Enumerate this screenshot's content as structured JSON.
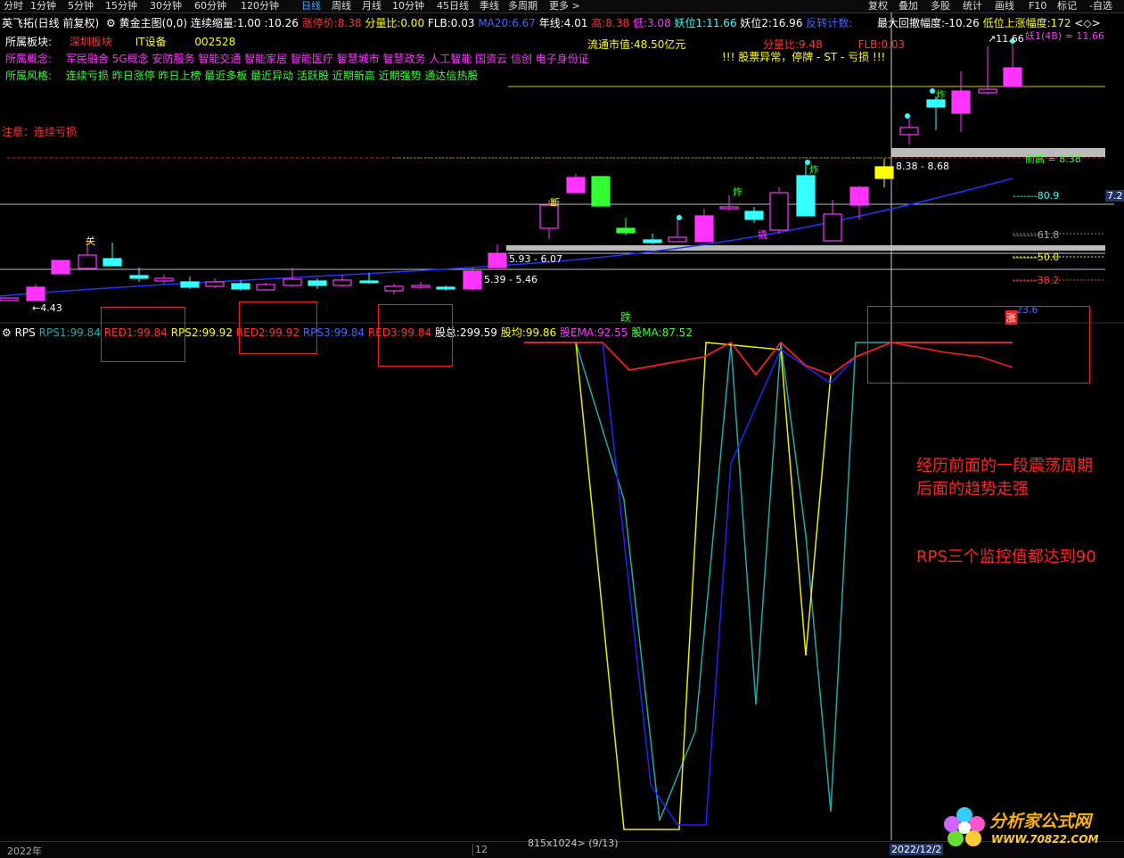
{
  "toolbar": {
    "items": [
      "分时",
      "1分钟",
      "5分钟",
      "15分钟",
      "30分钟",
      "60分钟",
      "120分钟",
      "日线",
      "周线",
      "月线",
      "10分钟",
      "45日线",
      "季线",
      "多周期",
      "更多 >"
    ],
    "active": "日线",
    "right_items": [
      "复权",
      "叠加",
      "多股",
      "统计",
      "画线",
      "F10",
      "标记",
      "-自选"
    ]
  },
  "header": {
    "stock_line": "英飞拓(日线 前复权)",
    "main_indicator": "黄金主图(0,0)",
    "continuous_shrink_label": "连续缩量:",
    "continuous_shrink_value": "1.00",
    "price_value": ":10.26",
    "limit_price_label": "涨停价:",
    "limit_price_value": "8.38",
    "fenliangbi_label": "分量比:",
    "fenliangbi_value": "0.00",
    "flb_label": "FLB:",
    "flb_value": "0.03",
    "ma20_label": "MA20:",
    "ma20_value": "6.67",
    "yearline_label": "年线:",
    "yearline_value": "4.01",
    "high_label": "高:",
    "high_value": "8.38",
    "low_label": "低:",
    "low_value": "3.08",
    "yao1_label": "妖位1:",
    "yao1_value": "11.66",
    "yao2_label": "妖位2:",
    "yao2_value": "16.96",
    "reverse_label": "反转计数:",
    "max_drawdown_label": "最大回撤幅度:",
    "max_drawdown_value": "-10.26",
    "low_rise_label": "低位上涨幅度:",
    "low_rise_value": "172"
  },
  "info": {
    "sector_label": "所属板块:",
    "sector_value1": "深圳板块",
    "sector_value2": "IT设备",
    "code": "002528",
    "market_cap_label": "流通市值:",
    "market_cap_value": "48.50亿元",
    "fenliangbi2_label": "分量比:",
    "fenliangbi2_value": "9.48",
    "flb2_label": "FLB:",
    "flb2_value": "0.03",
    "concept_label": "所属概念:",
    "concept_value": "军民融合 5G概念 安防服务 智能交通 智能家居 智能医疗 智慧城市 智慧政务 人工智能 国资云 信创 电子身份证",
    "warning": "!!! 股票异常，停牌 - ST - 亏损 !!!",
    "style_label": "所属风格:",
    "style_value": "连续亏损 昨日涨停 昨日上榜 最近多板 最近异动 活跃股 近期新高 近期强势 通达信热股",
    "note": "注意：连续亏损"
  },
  "price_labels": {
    "top_high": "11.66",
    "range_upper": "8.38 - 8.68",
    "range_mid": "5.93 - 6.07",
    "range_low": "5.39 - 5.46",
    "low_point": "4.43",
    "front_high": "前高 = 8.38",
    "right_axis": [
      "80.9",
      "61.8",
      "50.0",
      "38.2"
    ],
    "right_top": "7.2",
    "right_partial_top": "妖1(4B) = 11.66",
    "right_partial_bottom": "23.6",
    "tag_guan": "关",
    "tag_duan": "断",
    "tag_zha1": "炸",
    "tag_zha2": "炸",
    "tag_zha3": "炸",
    "tag_qiao": "撬"
  },
  "rps": {
    "title": "RPS",
    "rps1_label": "RPS1:",
    "rps1_value": "99.84",
    "red1_label": "RED1:",
    "red1_value": "99.84",
    "rps2_label": "RPS2:",
    "rps2_value": "99.92",
    "red2_label": "RED2:",
    "red2_value": "99.92",
    "rps3_label": "RPS3:",
    "rps3_value": "99.84",
    "red3_label": "RED3:",
    "red3_value": "99.84",
    "gu_zong_label": "股总:",
    "gu_zong_value": "299.59",
    "gu_jun_label": "股均:",
    "gu_jun_value": "99.86",
    "gu_ema_label": "股EMA:",
    "gu_ema_value": "92.55",
    "gu_ma_label": "股MA:",
    "gu_ma_value": "87.52",
    "tag_die": "跌",
    "tag_zhang": "涨"
  },
  "annotations": {
    "line1": "经历前面的一段震荡周期",
    "line2": "后面的趋势走强",
    "line3": "RPS三个监控值都达到90"
  },
  "watermark": "分析家公式网www.70822.com",
  "bottom": {
    "year_left": "2022年",
    "mark_12": "12",
    "size_info": "815x1024> (9/13)",
    "date_right": "2022/12/2"
  },
  "logo": {
    "name": "分析家公式网",
    "url": "WWW.70822.COM"
  },
  "colors": {
    "up": "#ff33ff",
    "down": "#33ffff",
    "limit_green": "#33ff33",
    "yellow": "#ffff00",
    "ma_blue": "#2233ff"
  }
}
